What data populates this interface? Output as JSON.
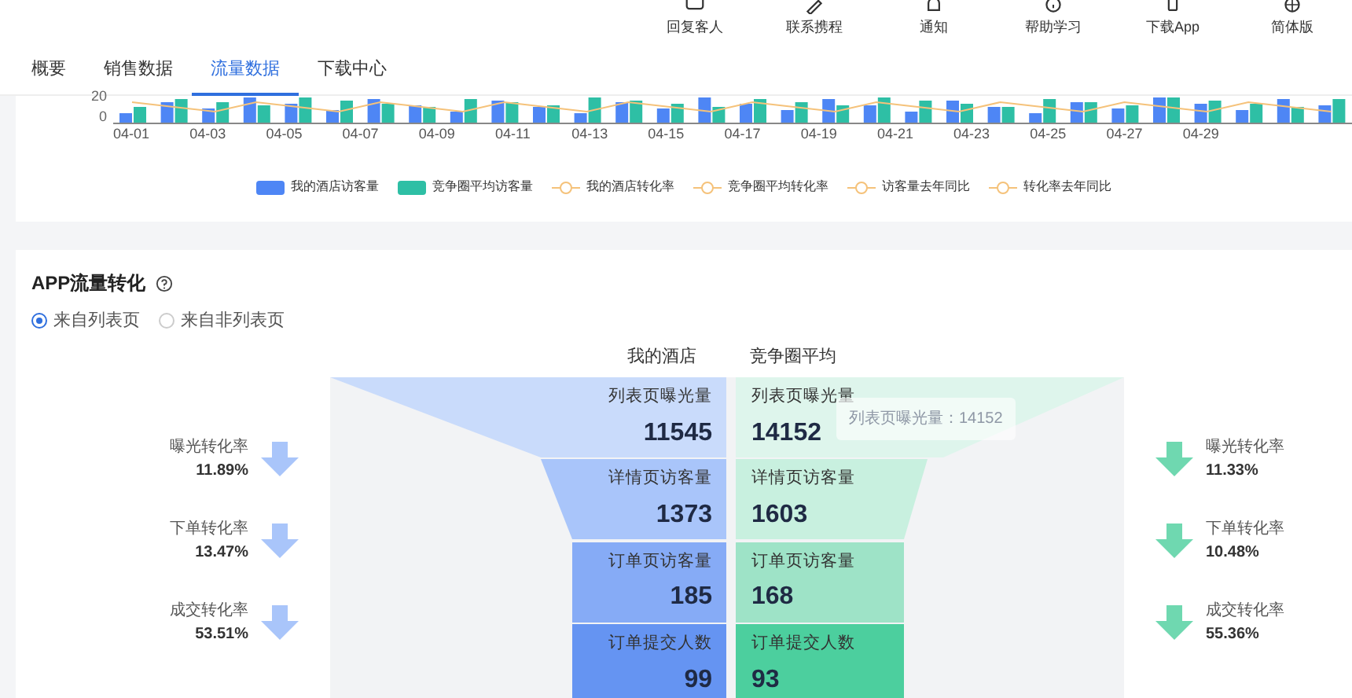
{
  "header": {
    "nav": [
      {
        "label": "回复客人"
      },
      {
        "label": "联系携程"
      },
      {
        "label": "通知"
      },
      {
        "label": "帮助学习"
      },
      {
        "label": "下载App"
      },
      {
        "label": "简体版"
      }
    ]
  },
  "tabs": [
    {
      "label": "概要",
      "selected": false
    },
    {
      "label": "销售数据",
      "selected": false
    },
    {
      "label": "流量数据",
      "selected": true
    },
    {
      "label": "下载中心",
      "selected": false
    }
  ],
  "traffic_chart": {
    "y_ticks": [
      "20",
      "0"
    ],
    "x_labels": [
      "04-01",
      "04-03",
      "04-05",
      "04-07",
      "04-09",
      "04-11",
      "04-13",
      "04-15",
      "04-17",
      "04-19",
      "04-21",
      "04-23",
      "04-25",
      "04-27",
      "04-29"
    ],
    "legend": [
      {
        "label": "我的酒店访客量",
        "kind": "bar",
        "color": "#4e86f5"
      },
      {
        "label": "竞争圈平均访客量",
        "kind": "bar",
        "color": "#2ebfa5"
      },
      {
        "label": "我的酒店转化率",
        "kind": "line",
        "color": "#f5c27a"
      },
      {
        "label": "竞争圈平均转化率",
        "kind": "line",
        "color": "#f5c27a"
      },
      {
        "label": "访客量去年同比",
        "kind": "line",
        "color": "#f5c27a"
      },
      {
        "label": "转化率去年同比",
        "kind": "line",
        "color": "#f5c27a"
      }
    ]
  },
  "conversion": {
    "title": "APP流量转化",
    "sources": [
      {
        "label": "来自列表页",
        "selected": true
      },
      {
        "label": "来自非列表页",
        "selected": false
      }
    ],
    "columns": [
      "我的酒店",
      "竞争圈平均"
    ],
    "stages": [
      {
        "mine_label": "列表页曝光量",
        "mine": "11545",
        "competitor_label": "列表页曝光量",
        "competitor": "14152"
      },
      {
        "mine_label": "详情页访客量",
        "mine": "1373",
        "competitor_label": "详情页访客量",
        "competitor": "1603"
      },
      {
        "mine_label": "订单页访客量",
        "mine": "185",
        "competitor_label": "订单页访客量",
        "competitor": "168"
      },
      {
        "mine_label": "订单提交人数",
        "mine": "99",
        "competitor_label": "订单提交人数",
        "competitor": "93"
      }
    ],
    "my_rates": [
      {
        "label": "曝光转化率",
        "value": "11.89%"
      },
      {
        "label": "下单转化率",
        "value": "13.47%"
      },
      {
        "label": "成交转化率",
        "value": "53.51%"
      }
    ],
    "competitor_rates": [
      {
        "label": "曝光转化率",
        "value": "11.33%"
      },
      {
        "label": "下单转化率",
        "value": "10.48%"
      },
      {
        "label": "成交转化率",
        "value": "55.36%"
      }
    ],
    "tooltip": "列表页曝光量：14152"
  }
}
